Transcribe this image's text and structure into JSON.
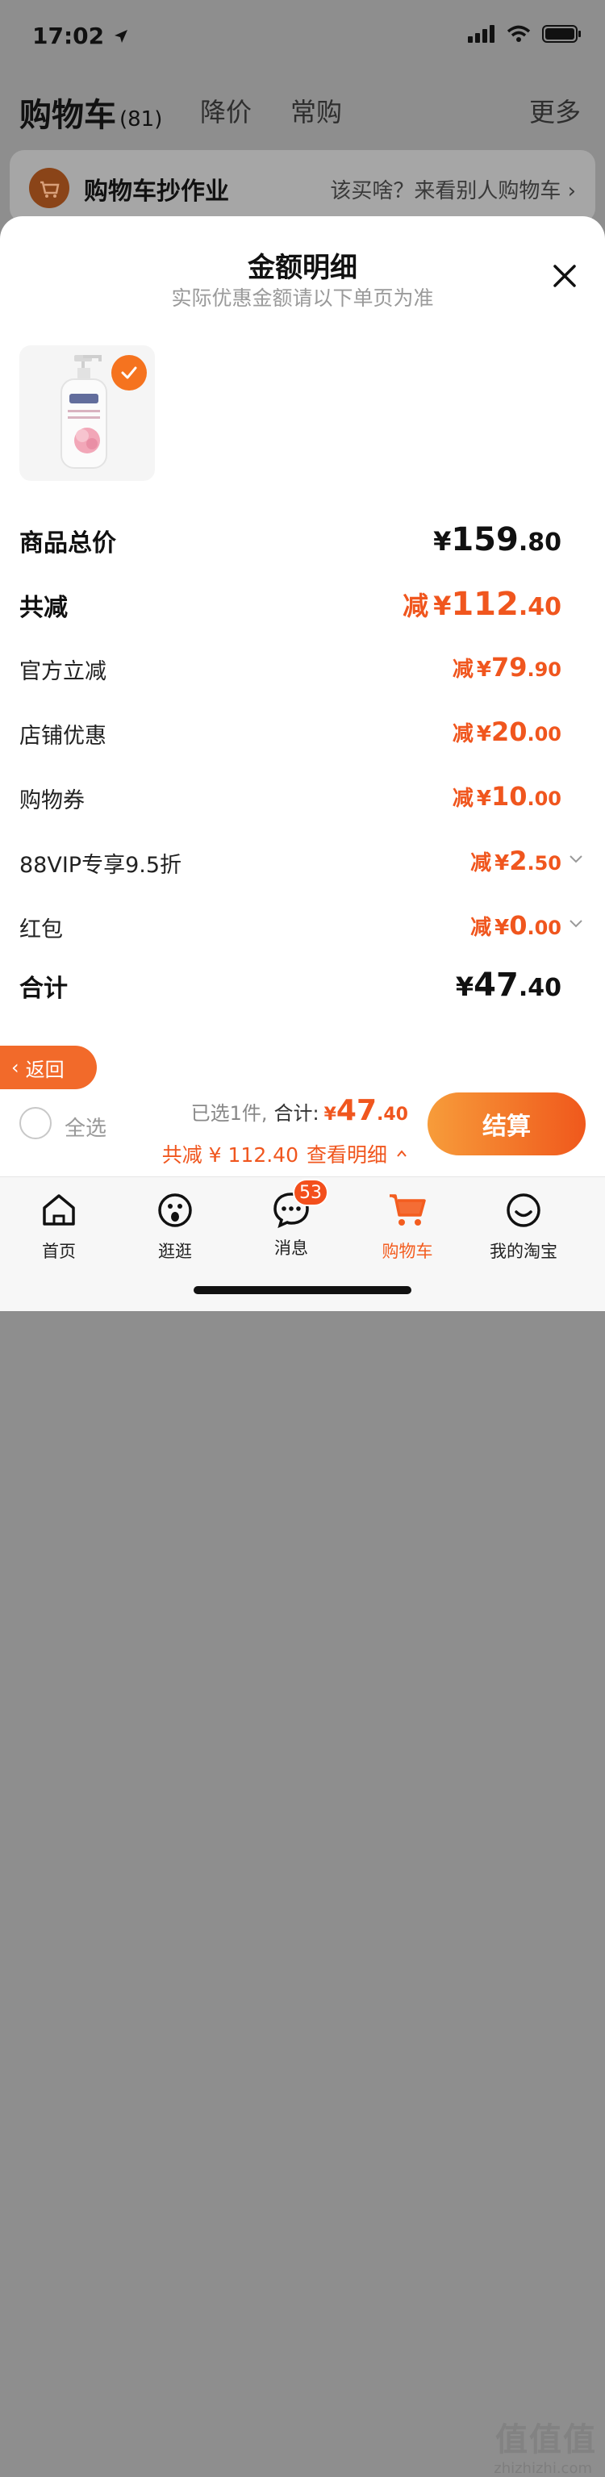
{
  "status": {
    "time": "17:02"
  },
  "background": {
    "title": "购物车",
    "count": "(81)",
    "tabs": [
      "降价",
      "常购"
    ],
    "more": "更多",
    "banner_title": "购物车抄作业",
    "banner_link": "该买啥？来看别人购物车"
  },
  "sheet": {
    "title": "金额明细",
    "subtitle": "实际优惠金额请以下单页为准",
    "rows": [
      {
        "label": "商品总价",
        "prefix": "",
        "currency": "¥",
        "int": "159",
        "dec": ".80"
      },
      {
        "label": "共减",
        "prefix": "减",
        "currency": "¥",
        "int": "112",
        "dec": ".40"
      },
      {
        "label": "官方立减",
        "prefix": "减",
        "currency": "¥",
        "int": "79",
        "dec": ".90"
      },
      {
        "label": "店铺优惠",
        "prefix": "减",
        "currency": "¥",
        "int": "20",
        "dec": ".00"
      },
      {
        "label": "购物券",
        "prefix": "减",
        "currency": "¥",
        "int": "10",
        "dec": ".00"
      },
      {
        "label": "88VIP专享9.5折",
        "prefix": "减",
        "currency": "¥",
        "int": "2",
        "dec": ".50"
      },
      {
        "label": "红包",
        "prefix": "减",
        "currency": "¥",
        "int": "0",
        "dec": ".00"
      },
      {
        "label": "合计",
        "prefix": "",
        "currency": "¥",
        "int": "47",
        "dec": ".40"
      }
    ]
  },
  "back_label": "返回",
  "checkout": {
    "select_all": "全选",
    "selected_text": "已选1件,",
    "total_label": "合计:",
    "total_currency": "¥",
    "total_int": "47",
    "total_dec": ".40",
    "discount_text": "共减 ¥ 112.40",
    "detail_link": "查看明细",
    "button": "结算"
  },
  "tabbar": {
    "items": [
      {
        "label": "首页",
        "icon": "home-icon"
      },
      {
        "label": "逛逛",
        "icon": "browse-icon"
      },
      {
        "label": "消息",
        "icon": "message-icon",
        "badge": "53"
      },
      {
        "label": "购物车",
        "icon": "cart-icon",
        "active": true
      },
      {
        "label": "我的淘宝",
        "icon": "profile-icon"
      }
    ]
  },
  "colors": {
    "accent": "#f0561e",
    "button_start": "#f79c3a",
    "button_end": "#f0581c"
  },
  "watermark": {
    "text": "值值值",
    "url": "zhizhizhi.com"
  }
}
